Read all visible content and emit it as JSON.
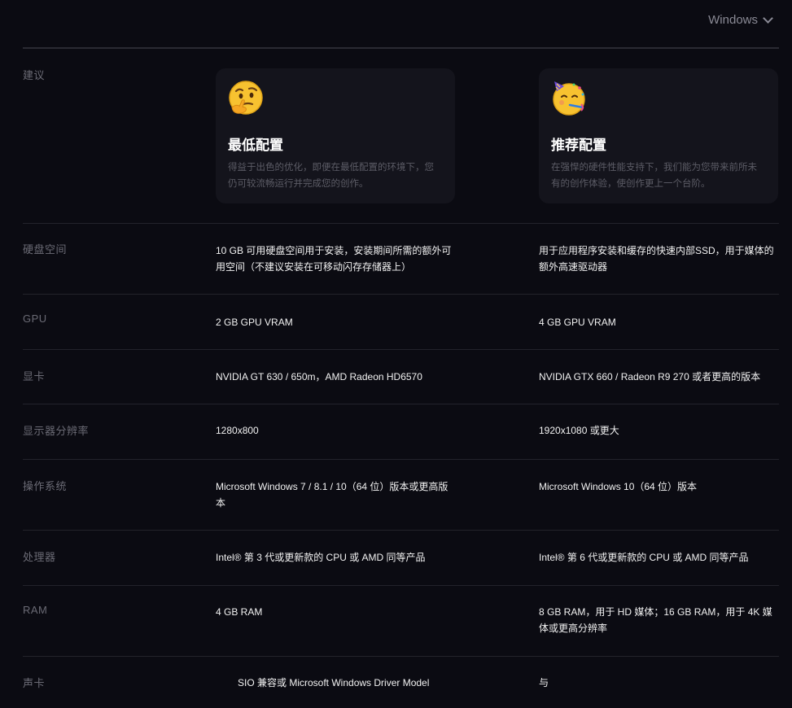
{
  "os_selector": {
    "label": "Windows"
  },
  "header": {
    "label": "建议",
    "tiers": [
      {
        "title": "最低配置",
        "description": "得益于出色的优化，即便在最低配置的环境下，您仍可较流畅运行并完成您的创作。",
        "icon": "thinking-face-icon"
      },
      {
        "title": "推荐配置",
        "description": "在强悍的硬件性能支持下，我们能为您带来前所未有的创作体验，使创作更上一个台阶。",
        "icon": "party-face-icon"
      }
    ]
  },
  "specs": [
    {
      "label": "硬盘空间",
      "min": "10 GB 可用硬盘空间用于安装，安装期间所需的额外可用空间（不建议安装在可移动闪存存储器上）",
      "rec": "用于应用程序安装和缓存的快速内部SSD，用于媒体的额外高速驱动器"
    },
    {
      "label": "GPU",
      "min": "2 GB GPU VRAM",
      "rec": "4 GB GPU VRAM"
    },
    {
      "label": "显卡",
      "min": "NVIDIA GT 630 / 650m，AMD Radeon HD6570",
      "rec": "NVIDIA GTX 660 / Radeon R9 270 或者更高的版本"
    },
    {
      "label": "显示器分辨率",
      "min": "1280x800",
      "rec": "1920x1080 或更大"
    },
    {
      "label": "操作系统",
      "min": "Microsoft Windows 7 / 8.1 / 10（64 位）版本或更高版本",
      "rec": "Microsoft Windows 10（64 位）版本"
    },
    {
      "label": "处理器",
      "min": "Intel® 第 3 代或更新款的 CPU 或 AMD 同等产品",
      "rec": "Intel® 第 6 代或更新款的 CPU 或 AMD 同等产品"
    },
    {
      "label": "RAM",
      "min": "4 GB RAM",
      "rec": "8 GB RAM，用于 HD 媒体；16 GB RAM，用于 4K 媒体或更高分辨率"
    },
    {
      "label": "声卡",
      "min": "SIO 兼容或 Microsoft Windows Driver Model",
      "rec": "与"
    }
  ],
  "colors": {
    "background": "#0b0b12",
    "card": "#14141c",
    "divider": "#23232b",
    "label": "#6b6b75",
    "muted_text": "#5c5c66",
    "value_text": "#f2f2f2"
  }
}
